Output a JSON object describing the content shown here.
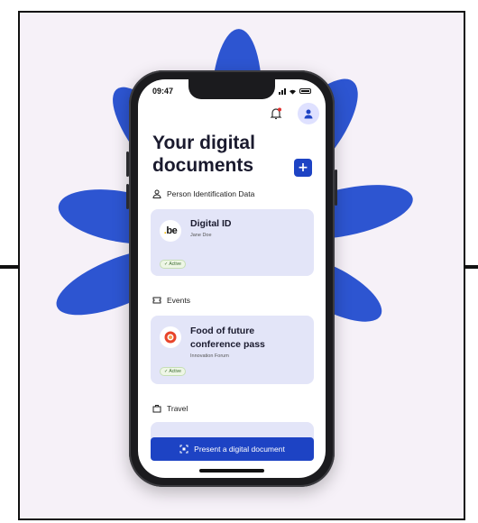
{
  "status_bar": {
    "time": "09:47"
  },
  "header": {
    "title": "Your digital documents",
    "add_label": "+"
  },
  "sections": {
    "pid": {
      "label": "Person Identification Data"
    },
    "events": {
      "label": "Events"
    },
    "travel": {
      "label": "Travel"
    }
  },
  "cards": {
    "digital_id": {
      "logo_text": "be",
      "title": "Digital ID",
      "subtitle": "Jane Doe",
      "status": "Active"
    },
    "conference": {
      "title_line1": "Food of future",
      "title_line2": "conference pass",
      "subtitle": "Innovation Forum",
      "status": "Active"
    }
  },
  "actions": {
    "present_label": "Present a digital document"
  },
  "icons": [
    "bell-icon",
    "user-icon",
    "plus-icon",
    "person-icon",
    "ticket-icon",
    "briefcase-icon",
    "qr-scan-icon"
  ],
  "colors": {
    "accent": "#1d43c4",
    "card": "#e3e5f8",
    "background": "#f6f1f8"
  }
}
